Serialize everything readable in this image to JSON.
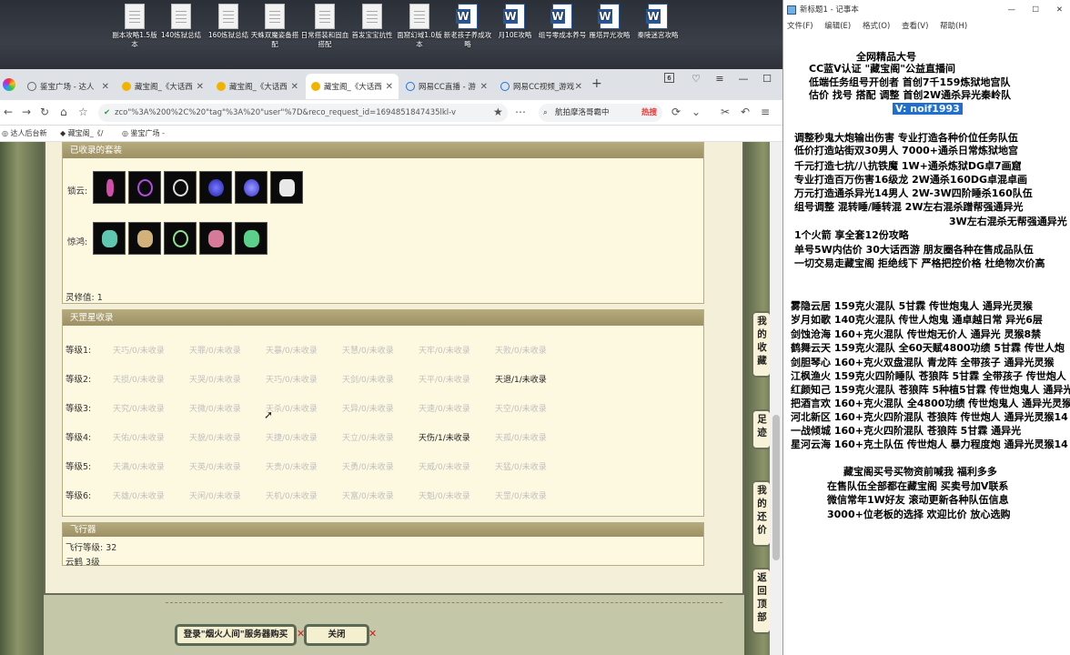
{
  "desktop_icons": [
    {
      "label": "副本攻略1.5版本",
      "type": "doc"
    },
    {
      "label": "140炼狱总结",
      "type": "doc"
    },
    {
      "label": "160炼狱总结",
      "type": "doc"
    },
    {
      "label": "天蛛双魔姿备搭配",
      "type": "doc"
    },
    {
      "label": "日常搭装和固血搭配",
      "type": "doc"
    },
    {
      "label": "首发宝宝抗性",
      "type": "doc"
    },
    {
      "label": "面窟幻域1.0版本",
      "type": "doc"
    },
    {
      "label": "新老孩子养成攻略",
      "type": "word"
    },
    {
      "label": "月10E攻略",
      "type": "word"
    },
    {
      "label": "组号零成本养号",
      "type": "word"
    },
    {
      "label": "雁塔异光攻略",
      "type": "word"
    },
    {
      "label": "秦陵迷宫攻略",
      "type": "word"
    }
  ],
  "browser": {
    "tabs": [
      "鉴宝广场 - 达人",
      "藏宝阁_《大话西",
      "藏宝阁_《大话西",
      "藏宝阁_《大话西",
      "网易CC直播 - 游",
      "网易CC视频_游戏"
    ],
    "tab_count": "6",
    "url": "zco\"%3A%200%2C%20\"tag\"%3A%20\"user\"%7D&reco_request_id=1694851847435lkl-v",
    "search_text": "航拍摩洛哥霸中",
    "hot_label": "热搜",
    "bookmarks": [
      "达人后台新",
      "藏宝阁_《/",
      "鉴宝广场 -"
    ]
  },
  "page": {
    "collected_section": {
      "title": "已收录的套装",
      "row1_label": "锁云:",
      "row2_label": "惊鸿:",
      "ling_xiu": "灵修值: 1"
    },
    "tianzhu": {
      "title": "天罡星收录",
      "rows": [
        {
          "label": "等级1:",
          "cells": [
            "天巧/0/未收录",
            "天罪/0/未收录",
            "天暴/0/未收录",
            "天慧/0/未收录",
            "天牢/0/未收录",
            "天败/0/未收录"
          ]
        },
        {
          "label": "等级2:",
          "cells": [
            "天损/0/未收录",
            "天哭/0/未收录",
            "天巧/0/未收录",
            "天剑/0/未收录",
            "天平/0/未收录",
            "天退/1/未收录"
          ]
        },
        {
          "label": "等级3:",
          "cells": [
            "天究/0/未收录",
            "天微/0/未收录",
            "天杀/0/未收录",
            "天异/0/未收录",
            "天速/0/未收录",
            "天空/0/未收录"
          ]
        },
        {
          "label": "等级4:",
          "cells": [
            "天佑/0/未收录",
            "天貌/0/未收录",
            "天捷/0/未收录",
            "天立/0/未收录",
            "天伤/1/未收录",
            "天孤/0/未收录"
          ]
        },
        {
          "label": "等级5:",
          "cells": [
            "天满/0/未收录",
            "天英/0/未收录",
            "天贵/0/未收录",
            "天勇/0/未收录",
            "天威/0/未收录",
            "天猛/0/未收录"
          ]
        },
        {
          "label": "等级6:",
          "cells": [
            "天雄/0/未收录",
            "天闲/0/未收录",
            "天机/0/未收录",
            "天富/0/未收录",
            "天魁/0/未收录",
            "天罡/0/未收录"
          ]
        }
      ]
    },
    "feixingqi": {
      "title": "飞行器",
      "level": "飞行等级: 32",
      "yunyu": "云鹤 3级"
    },
    "side_buttons": [
      "我的收藏",
      "足迹",
      "我的还价",
      "返回顶部"
    ],
    "bottom_buttons": [
      "登录\"烟火人间\"服务器购买",
      "关闭"
    ]
  },
  "notepad": {
    "title": "新标题1 - 记事本",
    "menu": [
      "文件(F)",
      "编辑(E)",
      "格式(O)",
      "查看(V)",
      "帮助(H)"
    ],
    "lines": [
      "全网精品大号",
      "CC蓝V认证 \"藏宝阁\"公益直播间",
      "低端任务组号开创者             首创7千159炼狱地宫队",
      "估价 找号 搭配 调整             首创2W通杀异光秦岭队",
      "V: noif1993",
      "调整秒鬼大炮输出伤害          专业打造各种价位任务队伍",
      "低价打造站街双30男人            7000+通杀日常炼狱地宫",
      "千元打造七抗/八抗铁魔             1W+通杀炼狱DG卓7画窟",
      "专业打造百万伤害16级龙            2W通杀160DG卓混卓画",
      "万元打造通杀异光14男人           2W-3W四阶睡杀160队伍",
      "组号调整 混转睡/睡转混           2W左右混杀蹭帮强通异光",
      "3W左右混杀无帮强通异光",
      "1个火箭 享全套12份攻略",
      "单号5W内估价 30大话西游          朋友圈各种在售成品队伍",
      "一切交易走藏宝阁 拒绝线下      严格把控价格 杜绝物次价高",
      "雾隐云居 159克火混队 5甘霖 传世炮鬼人 通异光灵猴",
      "岁月如歌 140克火混队 传世人炮鬼 通卓越日常 异光6层",
      "剑蚀沧海 160+克火混队 传世炮无价人 通异光 灵猴8禁",
      "鹤舞云天 159克火混队 全60天赋4800功绩 5甘霖 传世人炮",
      "剑胆琴心 160+克火双盘混队 青龙阵 全带孩子 通异光灵猴",
      "江枫渔火 159克火四阶睡队 苍狼阵 5甘霖 全带孩子 传世炮人",
      "红颜知己 159克火混队 苍狼阵 5种植5甘霖 传世炮鬼人 通异光",
      "把酒言欢 160+克火混队 全4800功绩 传世炮鬼人 通异光灵猴",
      "河北新区 160+克火四阶混队 苍狼阵 传世炮人 通异光灵猴14",
      "一战倾城 160+克火四阶混队 苍狼阵 5甘霖 通异光",
      "星河云海 160+克土队伍 传世炮人 暴力程度炮 通异光灵猴14",
      "藏宝阁买号买物资前喊我 福利多多",
      "在售队伍全部都在藏宝阁 买卖号加V联系",
      "微信常年1W好友 滚动更新各种队伍信息",
      "3000+位老板的选择 欢迎比价 放心选购"
    ]
  },
  "colors": {
    "accent": "#1f6fd0",
    "panel_header": "#a89c6e",
    "panel_bg": "#fdf9e0",
    "frame": "#6b6d58"
  }
}
